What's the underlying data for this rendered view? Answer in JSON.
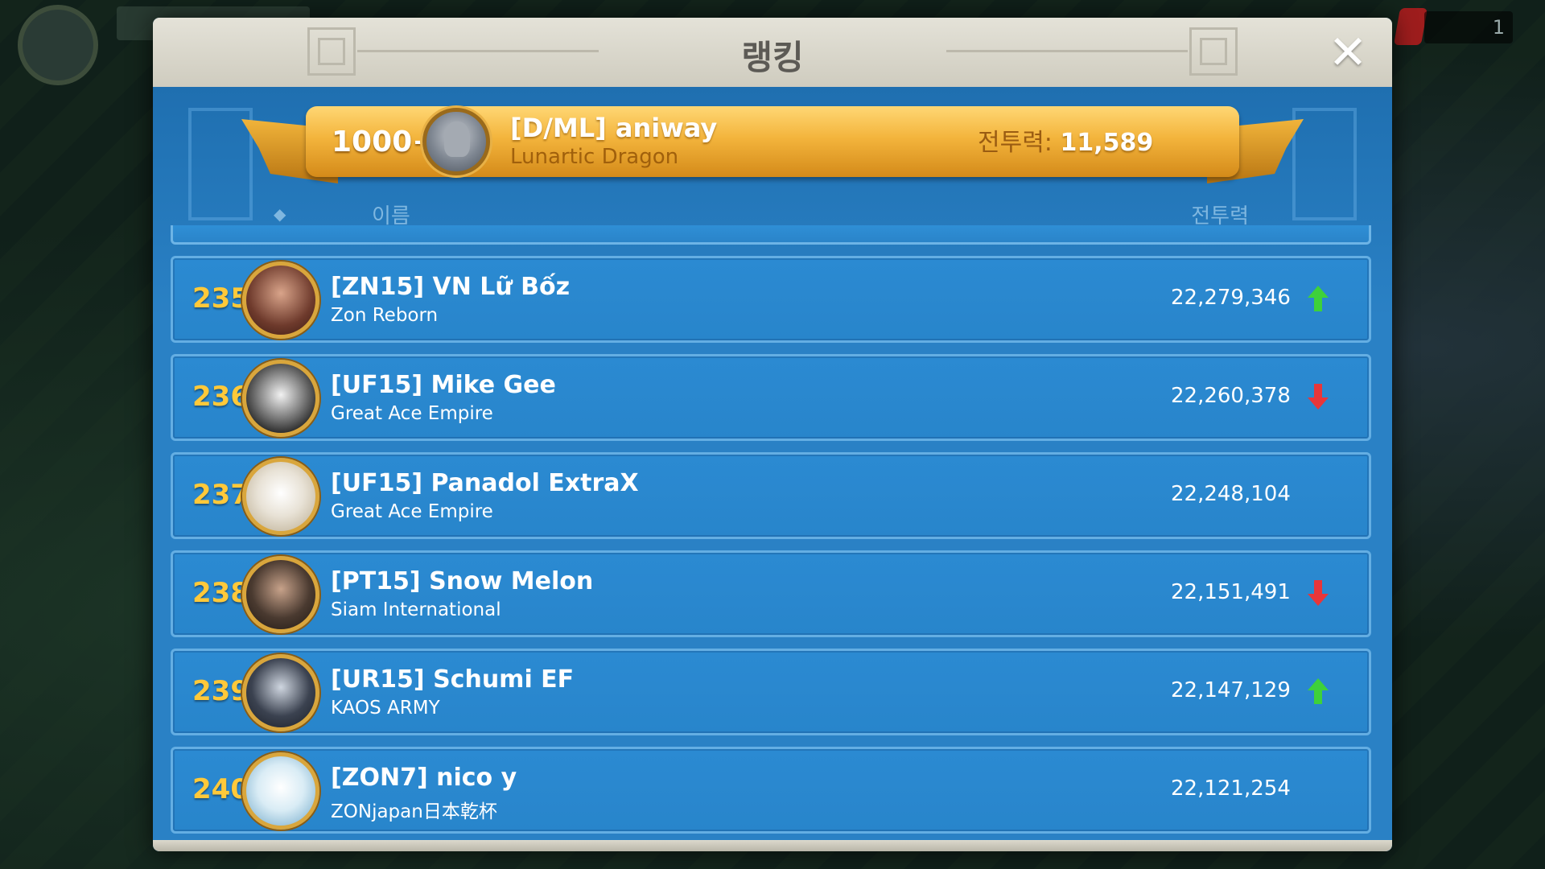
{
  "background": {
    "counter": "1"
  },
  "modal": {
    "title": "랭킹",
    "close_icon": "✕"
  },
  "my_rank": {
    "rank": "1000+",
    "name": "[D/ML] aniway",
    "alliance": "Lunartic Dragon",
    "power_label": "전투력: ",
    "power_value": "11,589"
  },
  "columns": {
    "rank_marker": "◆",
    "name": "이름",
    "power": "전투력"
  },
  "rows": [
    {
      "rank": "235",
      "name": "[ZN15] VN Lữ Bốz",
      "alliance": "Zon Reborn",
      "power": "22,279,346",
      "trend": "up",
      "avatar_color": "#6e3a2c"
    },
    {
      "rank": "236",
      "name": "[UF15] Mike Gee",
      "alliance": "Great Ace Empire",
      "power": "22,260,378",
      "trend": "down",
      "avatar_color": "#2c2c2c"
    },
    {
      "rank": "237",
      "name": "[UF15] Panadol ExtraX",
      "alliance": "Great Ace Empire",
      "power": "22,248,104",
      "trend": "none",
      "avatar_color": "#e8e2d6"
    },
    {
      "rank": "238",
      "name": "[PT15] Snow Melon",
      "alliance": "Siam International",
      "power": "22,151,491",
      "trend": "down",
      "avatar_color": "#4a3a30"
    },
    {
      "rank": "239",
      "name": "[UR15] Schumi EF",
      "alliance": "KAOS ARMY",
      "power": "22,147,129",
      "trend": "up",
      "avatar_color": "#3b4250"
    },
    {
      "rank": "240",
      "name": "[ZON7] nico y",
      "alliance": "ZONjapan日本乾杯",
      "power": "22,121,254",
      "trend": "none",
      "avatar_color": "#d9ecf5"
    }
  ],
  "colors": {
    "trend_up": "#3ed13a",
    "trend_down": "#e8363a",
    "rank_gold": "#ffc93a"
  }
}
